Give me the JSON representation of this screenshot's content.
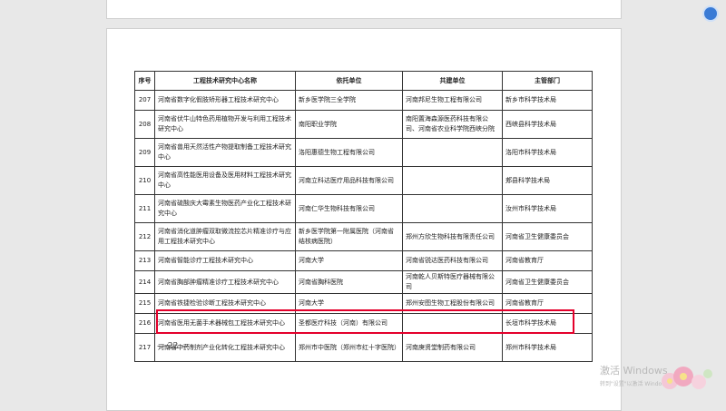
{
  "table": {
    "headers": [
      "序号",
      "工程技术研究中心名称",
      "依托单位",
      "共建单位",
      "主管部门"
    ],
    "rows": [
      [
        "207",
        "河南省数字化假肢矫形器工程技术研究中心",
        "新乡医学院三全学院",
        "河南邦尼生物工程有限公司",
        "新乡市科学技术局"
      ],
      [
        "208",
        "河南省伏牛山特色药用植物开发与利用工程技术研究中心",
        "南阳职业学院",
        "南阳置海森源医药科技有限公司、河南省农业科学院西峡分院",
        "西峡县科学技术局"
      ],
      [
        "209",
        "河南省兽用天然活性产物提取制备工程技术研究中心",
        "洛阳惠德生物工程有限公司",
        "",
        "洛阳市科学技术局"
      ],
      [
        "210",
        "河南省高性能医用设备及医用材料工程技术研究中心",
        "河南立科达医疗用品科技有限公司",
        "",
        "郏县科学技术局"
      ],
      [
        "211",
        "河南省硫酸庆大霉素生物医药产业化工程技术研究中心",
        "河南仁华生物科技有限公司",
        "",
        "汝州市科学技术局"
      ],
      [
        "212",
        "河南省消化道肿瘤双取微流控芯片精准诊疗与应用工程技术研究中心",
        "新乡医学院第一附属医院（河南省结核病医院）",
        "郑州方欣生物科技有限责任公司",
        "河南省卫生健康委员会"
      ],
      [
        "213",
        "河南省智能诊疗工程技术研究中心",
        "河南大学",
        "河南省锐达医药科技有限公司",
        "河南省教育厅"
      ],
      [
        "214",
        "河南省胸部肿瘤精准诊疗工程技术研究中心",
        "河南省胸科医院",
        "河南乾人贝斯特医疗器械有限公司",
        "河南省卫生健康委员会"
      ],
      [
        "215",
        "河南省铁捷检验诊断工程技术研究中心",
        "河南大学",
        "郑州安图生物工程股份有限公司",
        "河南省教育厅"
      ],
      [
        "216",
        "河南省医用无菌手术器械包工程技术研究中心",
        "圣都医疗科技（河南）有限公司",
        "",
        "长垣市科学技术局"
      ],
      [
        "217",
        "河南省中药制剂产业化转化工程技术研究中心",
        "郑州市中医院（郑州市红十字医院）",
        "河南庚贤堂制药有限公司",
        "郑州市科学技术局"
      ]
    ]
  },
  "page_number": "— 22 —",
  "watermark": {
    "line1": "激活 Windows",
    "line2": "转到\"设置\"以激活 Windows。"
  },
  "colors": {
    "highlight": "#e4002b",
    "corner_icon": "#3a7bd5"
  }
}
